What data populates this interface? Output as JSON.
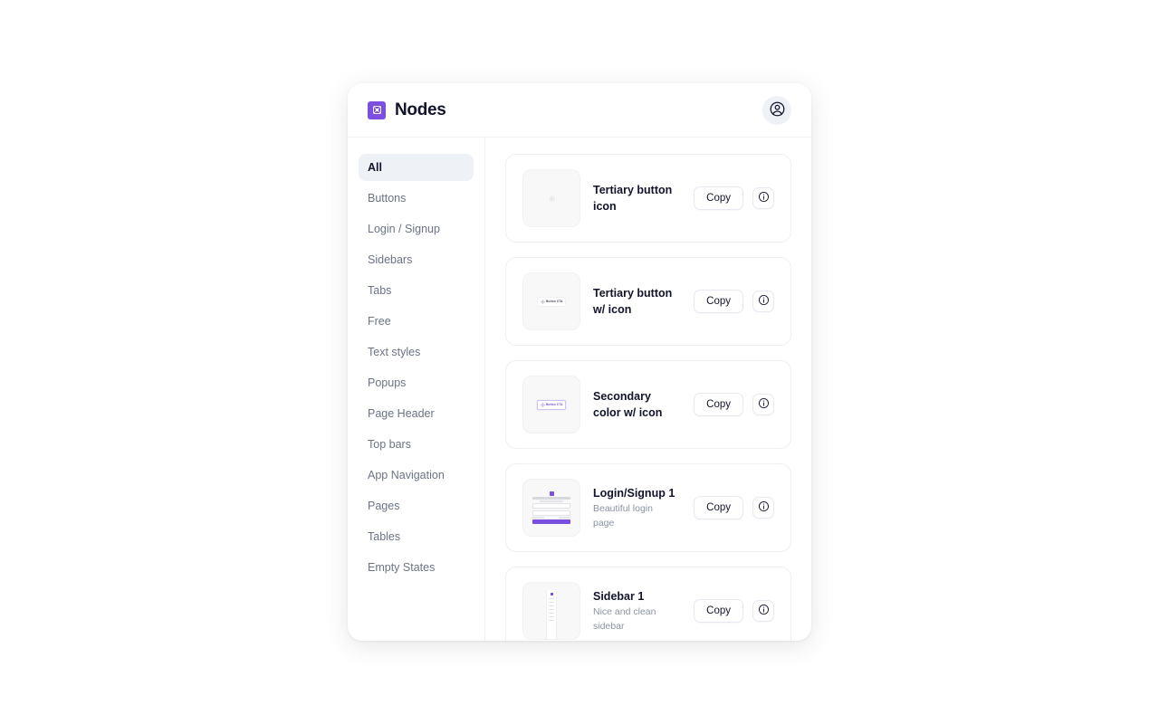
{
  "header": {
    "brand_name": "Nodes",
    "logo_icon": "nodes-square-logo-icon",
    "avatar_icon": "user-circle-icon"
  },
  "sidebar": {
    "items": [
      {
        "label": "All",
        "active": true
      },
      {
        "label": "Buttons",
        "active": false
      },
      {
        "label": "Login / Signup",
        "active": false
      },
      {
        "label": "Sidebars",
        "active": false
      },
      {
        "label": "Tabs",
        "active": false
      },
      {
        "label": "Free",
        "active": false
      },
      {
        "label": "Text styles",
        "active": false
      },
      {
        "label": "Popups",
        "active": false
      },
      {
        "label": "Page Header",
        "active": false
      },
      {
        "label": "Top bars",
        "active": false
      },
      {
        "label": "App Navigation",
        "active": false
      },
      {
        "label": "Pages",
        "active": false
      },
      {
        "label": "Tables",
        "active": false
      },
      {
        "label": "Empty States",
        "active": false
      }
    ]
  },
  "content": {
    "copy_label": "Copy",
    "info_icon": "info-circle-icon",
    "cards": [
      {
        "title": "Tertiary button icon",
        "subtitle": "",
        "preview": "tertiary-icon-only",
        "preview_label": ""
      },
      {
        "title": "Tertiary button w/ icon",
        "subtitle": "",
        "preview": "tertiary-with-icon",
        "preview_label": "Button CTA"
      },
      {
        "title": "Secondary color w/ icon",
        "subtitle": "",
        "preview": "secondary-with-icon",
        "preview_label": "Button CTA"
      },
      {
        "title": "Login/Signup 1",
        "subtitle": "Beautiful login page",
        "preview": "login-page",
        "preview_label": ""
      },
      {
        "title": "Sidebar 1",
        "subtitle": "Nice and clean sidebar",
        "preview": "sidebar",
        "preview_label": ""
      }
    ]
  },
  "colors": {
    "brand_purple": "#7b4fe0",
    "ink": "#11142b",
    "muted": "#8b93a5",
    "active_bg": "#eef1f6",
    "border": "#eef0f4"
  }
}
